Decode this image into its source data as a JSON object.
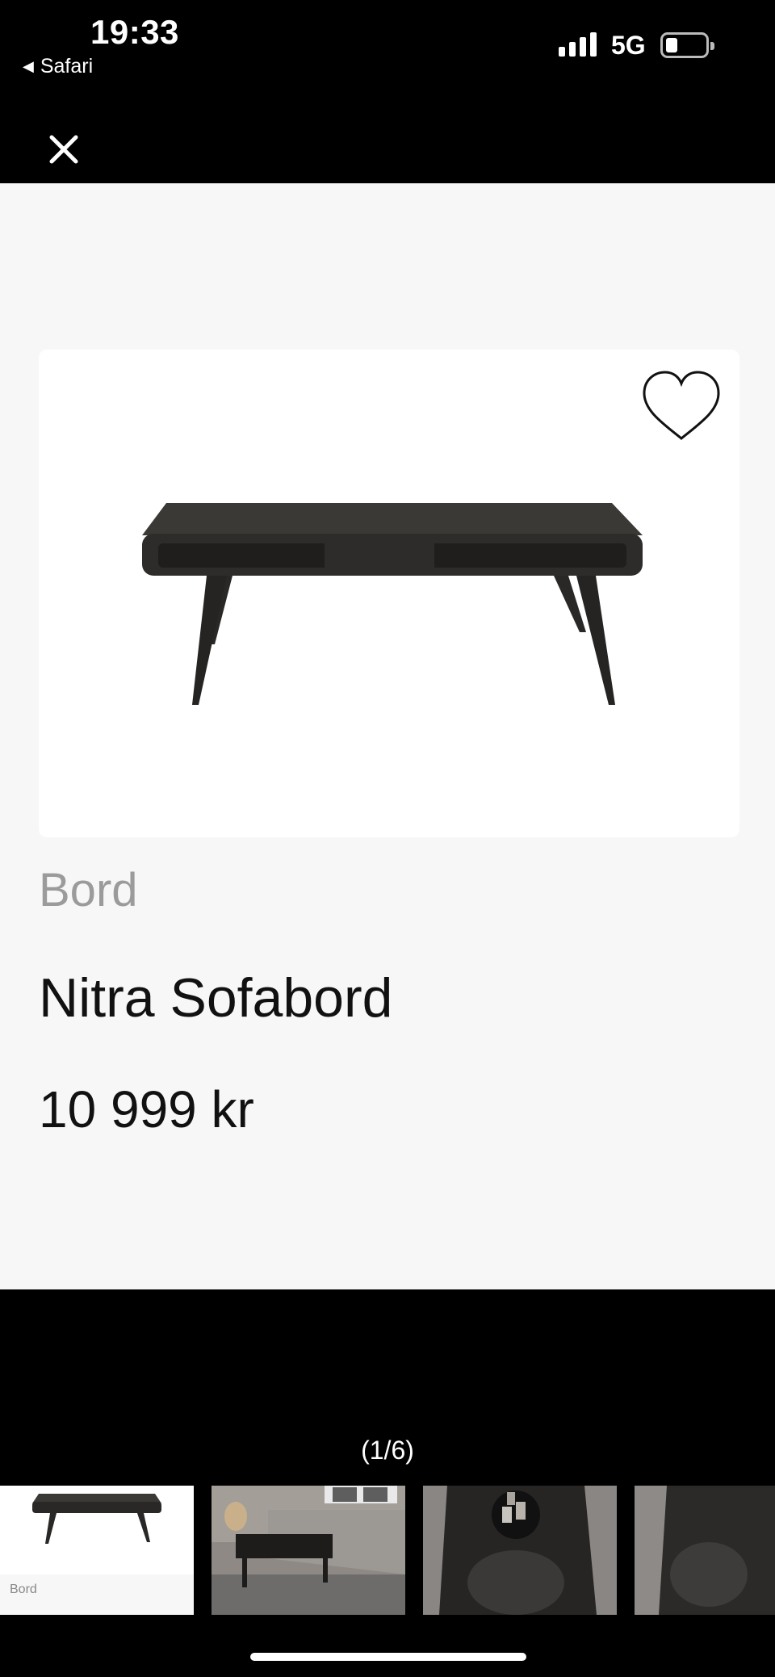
{
  "status_bar": {
    "time": "19:33",
    "back_app": "Safari",
    "network": "5G",
    "icons": [
      "signal-icon",
      "battery-icon"
    ]
  },
  "nav": {
    "close_icon": "close-icon"
  },
  "product": {
    "category": "Bord",
    "name": "Nitra Sofabord",
    "price": "10 999 kr",
    "favorite_icon": "heart-icon"
  },
  "gallery": {
    "counter": "(1/6)",
    "thumbnails": [
      {
        "caption": "Bord"
      }
    ]
  }
}
